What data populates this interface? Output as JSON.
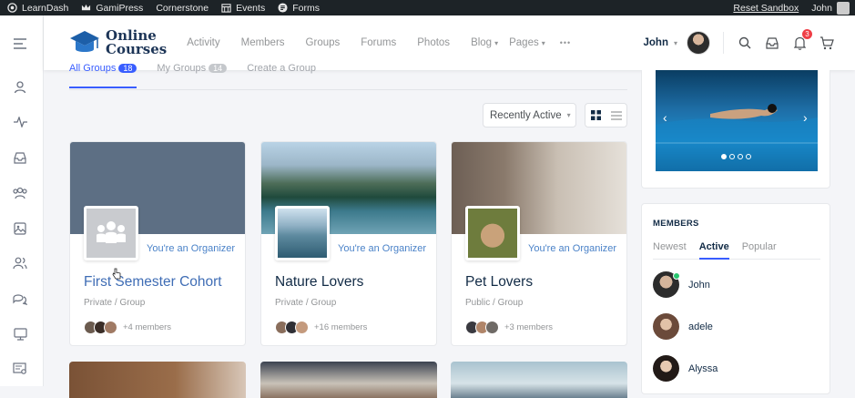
{
  "adminbar": {
    "items": [
      {
        "label": "LearnDash",
        "icon": "learndash-icon"
      },
      {
        "label": "GamiPress",
        "icon": "crown-icon"
      },
      {
        "label": "Cornerstone",
        "icon": ""
      },
      {
        "label": "Events",
        "icon": "calendar-icon"
      },
      {
        "label": "Forms",
        "icon": "forms-icon"
      }
    ],
    "reset_label": "Reset Sandbox",
    "user_label": "John"
  },
  "header": {
    "logo_line1": "Online",
    "logo_line2": "Courses",
    "nav": [
      "Activity",
      "Members",
      "Groups",
      "Forums",
      "Photos"
    ],
    "nav_dropdowns": [
      "Blog",
      "Pages"
    ],
    "more_label": "•••",
    "user_name": "John",
    "notification_count": "3"
  },
  "groups_tabs": {
    "all_label": "All Groups",
    "all_count": "18",
    "my_label": "My Groups",
    "my_count": "14",
    "create_label": "Create a Group"
  },
  "sort": {
    "selected": "Recently Active"
  },
  "groups": [
    {
      "title": "First Semester Cohort",
      "role": "You're an Organizer",
      "meta": "Private / Group",
      "members": "+4 members"
    },
    {
      "title": "Nature Lovers",
      "role": "You're an Organizer",
      "meta": "Private / Group",
      "members": "+16 members"
    },
    {
      "title": "Pet Lovers",
      "role": "You're an Organizer",
      "meta": "Public / Group",
      "members": "+3 members"
    }
  ],
  "members_widget": {
    "title": "MEMBERS",
    "tabs": [
      "Newest",
      "Active",
      "Popular"
    ],
    "active_tab": "Active",
    "members": [
      "John",
      "adele",
      "Alyssa"
    ]
  },
  "colors": {
    "accent": "#385dff",
    "role_link": "#4a82c8",
    "title_link": "#3f6db5",
    "online": "#28c76f",
    "badge": "#ef3e46"
  }
}
